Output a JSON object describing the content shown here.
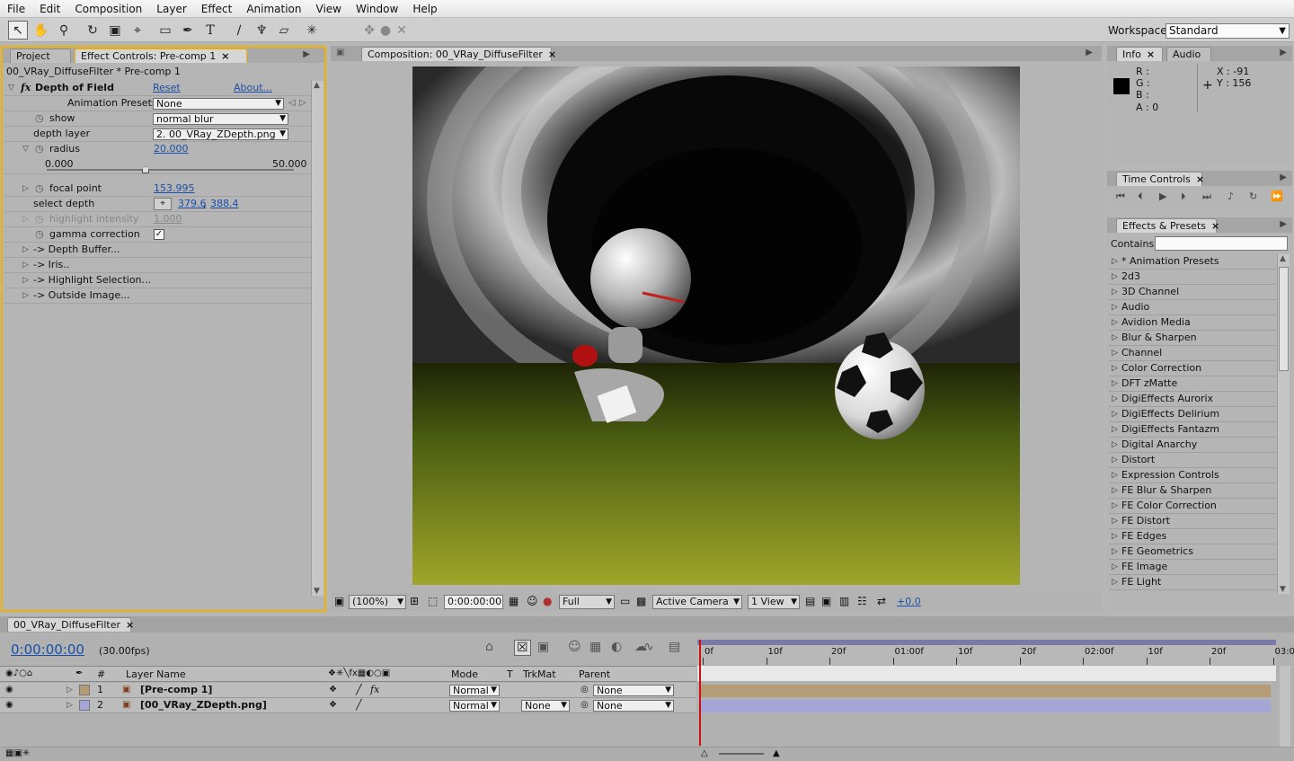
{
  "menubar": [
    "File",
    "Edit",
    "Composition",
    "Layer",
    "Effect",
    "Animation",
    "View",
    "Window",
    "Help"
  ],
  "workspace": {
    "label": "Workspace:",
    "value": "Standard"
  },
  "tools": [
    "selection-tool",
    "hand-tool",
    "zoom-tool",
    "rotate-tool",
    "camera-tool",
    "pan-behind-tool",
    "rectangle-tool",
    "pen-tool",
    "text-tool",
    "brush-tool",
    "clone-stamp-tool",
    "eraser-tool",
    "puppet-pin-tool"
  ],
  "left_panel": {
    "tabs": [
      "Project",
      "Effect Controls: Pre-comp 1"
    ],
    "title": "00_VRay_DiffuseFilter * Pre-comp 1",
    "effect": {
      "name": "Depth of Field",
      "reset": "Reset",
      "about": "About..."
    },
    "presets": {
      "label": "Animation Presets:",
      "value": "None"
    },
    "params": {
      "show": {
        "label": "show",
        "value": "normal blur"
      },
      "depth_layer": {
        "label": "depth layer",
        "value": "2. 00_VRay_ZDepth.png"
      },
      "radius": {
        "label": "radius",
        "value": "20.000",
        "min": "0.000",
        "max": "50.000",
        "slider_fraction": 0.4
      },
      "focal_point": {
        "label": "focal point",
        "value": "153.995"
      },
      "select_depth": {
        "label": "select depth",
        "x": "379.6",
        "y": "388.4"
      },
      "highlight_intensity": {
        "label": "highlight intensity",
        "value": "1.000"
      },
      "gamma_correction": {
        "label": "gamma correction",
        "checked": true
      }
    },
    "groups": [
      "-> Depth Buffer...",
      "-> Iris..",
      "-> Highlight Selection...",
      "-> Outside Image..."
    ]
  },
  "composition": {
    "tab": "Composition: 00_VRay_DiffuseFilter",
    "zoom": "(100%)",
    "time": "0:00:00:00",
    "resolution": "Full",
    "camera": "Active Camera",
    "views": "1 View",
    "exposure": "+0.0"
  },
  "info": {
    "tabs": [
      "Info",
      "Audio"
    ],
    "r": "R :",
    "g": "G :",
    "b": "B :",
    "a": "A : 0",
    "x": "X : -91",
    "y": "Y : 156"
  },
  "time_controls": {
    "tab": "Time Controls"
  },
  "effects_presets": {
    "tab": "Effects & Presets",
    "contains_label": "Contains:",
    "items": [
      "* Animation Presets",
      "2d3",
      "3D Channel",
      "Audio",
      "Avidion Media",
      "Blur & Sharpen",
      "Channel",
      "Color Correction",
      "DFT zMatte",
      "DigiEffects Aurorix",
      "DigiEffects Delirium",
      "DigiEffects Fantazm",
      "Digital Anarchy",
      "Distort",
      "Expression Controls",
      "FE Blur & Sharpen",
      "FE Color Correction",
      "FE Distort",
      "FE Edges",
      "FE Geometrics",
      "FE Image",
      "FE Light"
    ]
  },
  "timeline": {
    "tab": "00_VRay_DiffuseFilter",
    "time": "0:00:00:00",
    "fps": "(30.00fps)",
    "headers": {
      "num": "#",
      "layer_name": "Layer Name",
      "mode": "Mode",
      "t": "T",
      "trkmat": "TrkMat",
      "parent": "Parent"
    },
    "ruler": [
      "0f",
      "10f",
      "20f",
      "01:00f",
      "10f",
      "20f",
      "02:00f",
      "10f",
      "20f",
      "03:0"
    ],
    "layers": [
      {
        "num": "1",
        "name": "[Pre-comp 1]",
        "mode": "Normal",
        "trkmat": "",
        "parent": "None",
        "color": "#b39c76"
      },
      {
        "num": "2",
        "name": "[00_VRay_ZDepth.png]",
        "mode": "Normal",
        "trkmat": "None",
        "parent": "None",
        "color": "#a5a5d8"
      }
    ]
  }
}
